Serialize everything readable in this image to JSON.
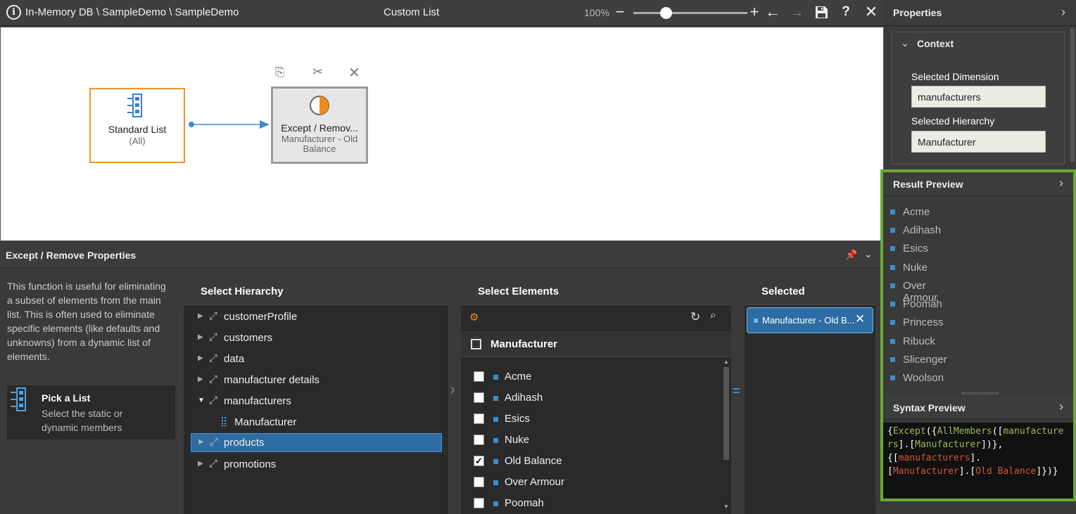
{
  "topbar": {
    "breadcrumb": "In-Memory DB \\ SampleDemo \\ SampleDemo",
    "title": "Custom List",
    "zoom": "100%"
  },
  "canvas": {
    "standard_node": {
      "name": "Standard List",
      "sub": "(All)"
    },
    "except_node": {
      "name": "Except / Remov...",
      "sub": "Manufacturer - Old Balance"
    }
  },
  "bottom_panel": {
    "title": "Except / Remove Properties",
    "description": "This function is useful for eliminating a subset of elements from the main list. This is often used to eliminate specific elements (like defaults and unknowns) from a dynamic list of elements.",
    "pick_list": {
      "title": "Pick a List",
      "subtitle": "Select the static or dynamic members"
    },
    "hierarchy": {
      "header": "Select Hierarchy",
      "items": [
        "customerProfile",
        "customers",
        "data",
        "manufacturer details",
        "manufacturers",
        "Manufacturer",
        "products",
        "promotions"
      ],
      "selected": "products"
    },
    "elements": {
      "header": "Select Elements",
      "group": "Manufacturer",
      "items": [
        "Acme",
        "Adihash",
        "Esics",
        "Nuke",
        "Old Balance",
        "Over Armour",
        "Poomah"
      ],
      "checked": [
        "Old Balance"
      ]
    },
    "selected": {
      "header": "Selected",
      "chip": "Manufacturer - Old B..."
    }
  },
  "properties": {
    "header": "Properties",
    "context_label": "Context",
    "dimension_label": "Selected Dimension",
    "dimension_value": "manufacturers",
    "hierarchy_label": "Selected Hierarchy",
    "hierarchy_value": "Manufacturer"
  },
  "result_preview": {
    "header": "Result Preview",
    "items": [
      "Acme",
      "Adihash",
      "Esics",
      "Nuke",
      "Over Armour",
      "Poomah",
      "Princess",
      "Ribuck",
      "Slicenger",
      "Woolson"
    ]
  },
  "syntax_preview": {
    "header": "Syntax Preview",
    "s1": "{",
    "s2": "Except",
    "s3": "({",
    "s4": "AllMembers",
    "s5": "([",
    "s6": "manufacturers",
    "s7": "].[",
    "s8": "Manufacturer",
    "s9": "])},",
    "s10": "{[",
    "s11": "manufacturers",
    "s12": "].",
    "s13": "[",
    "s14": "Manufacturer",
    "s15": "].[",
    "s16": "Old Balance",
    "s17": "]})}"
  },
  "colors": {
    "accent": "#3b8ec9",
    "highlight": "#6aaa35",
    "node_border": "#f29425"
  }
}
